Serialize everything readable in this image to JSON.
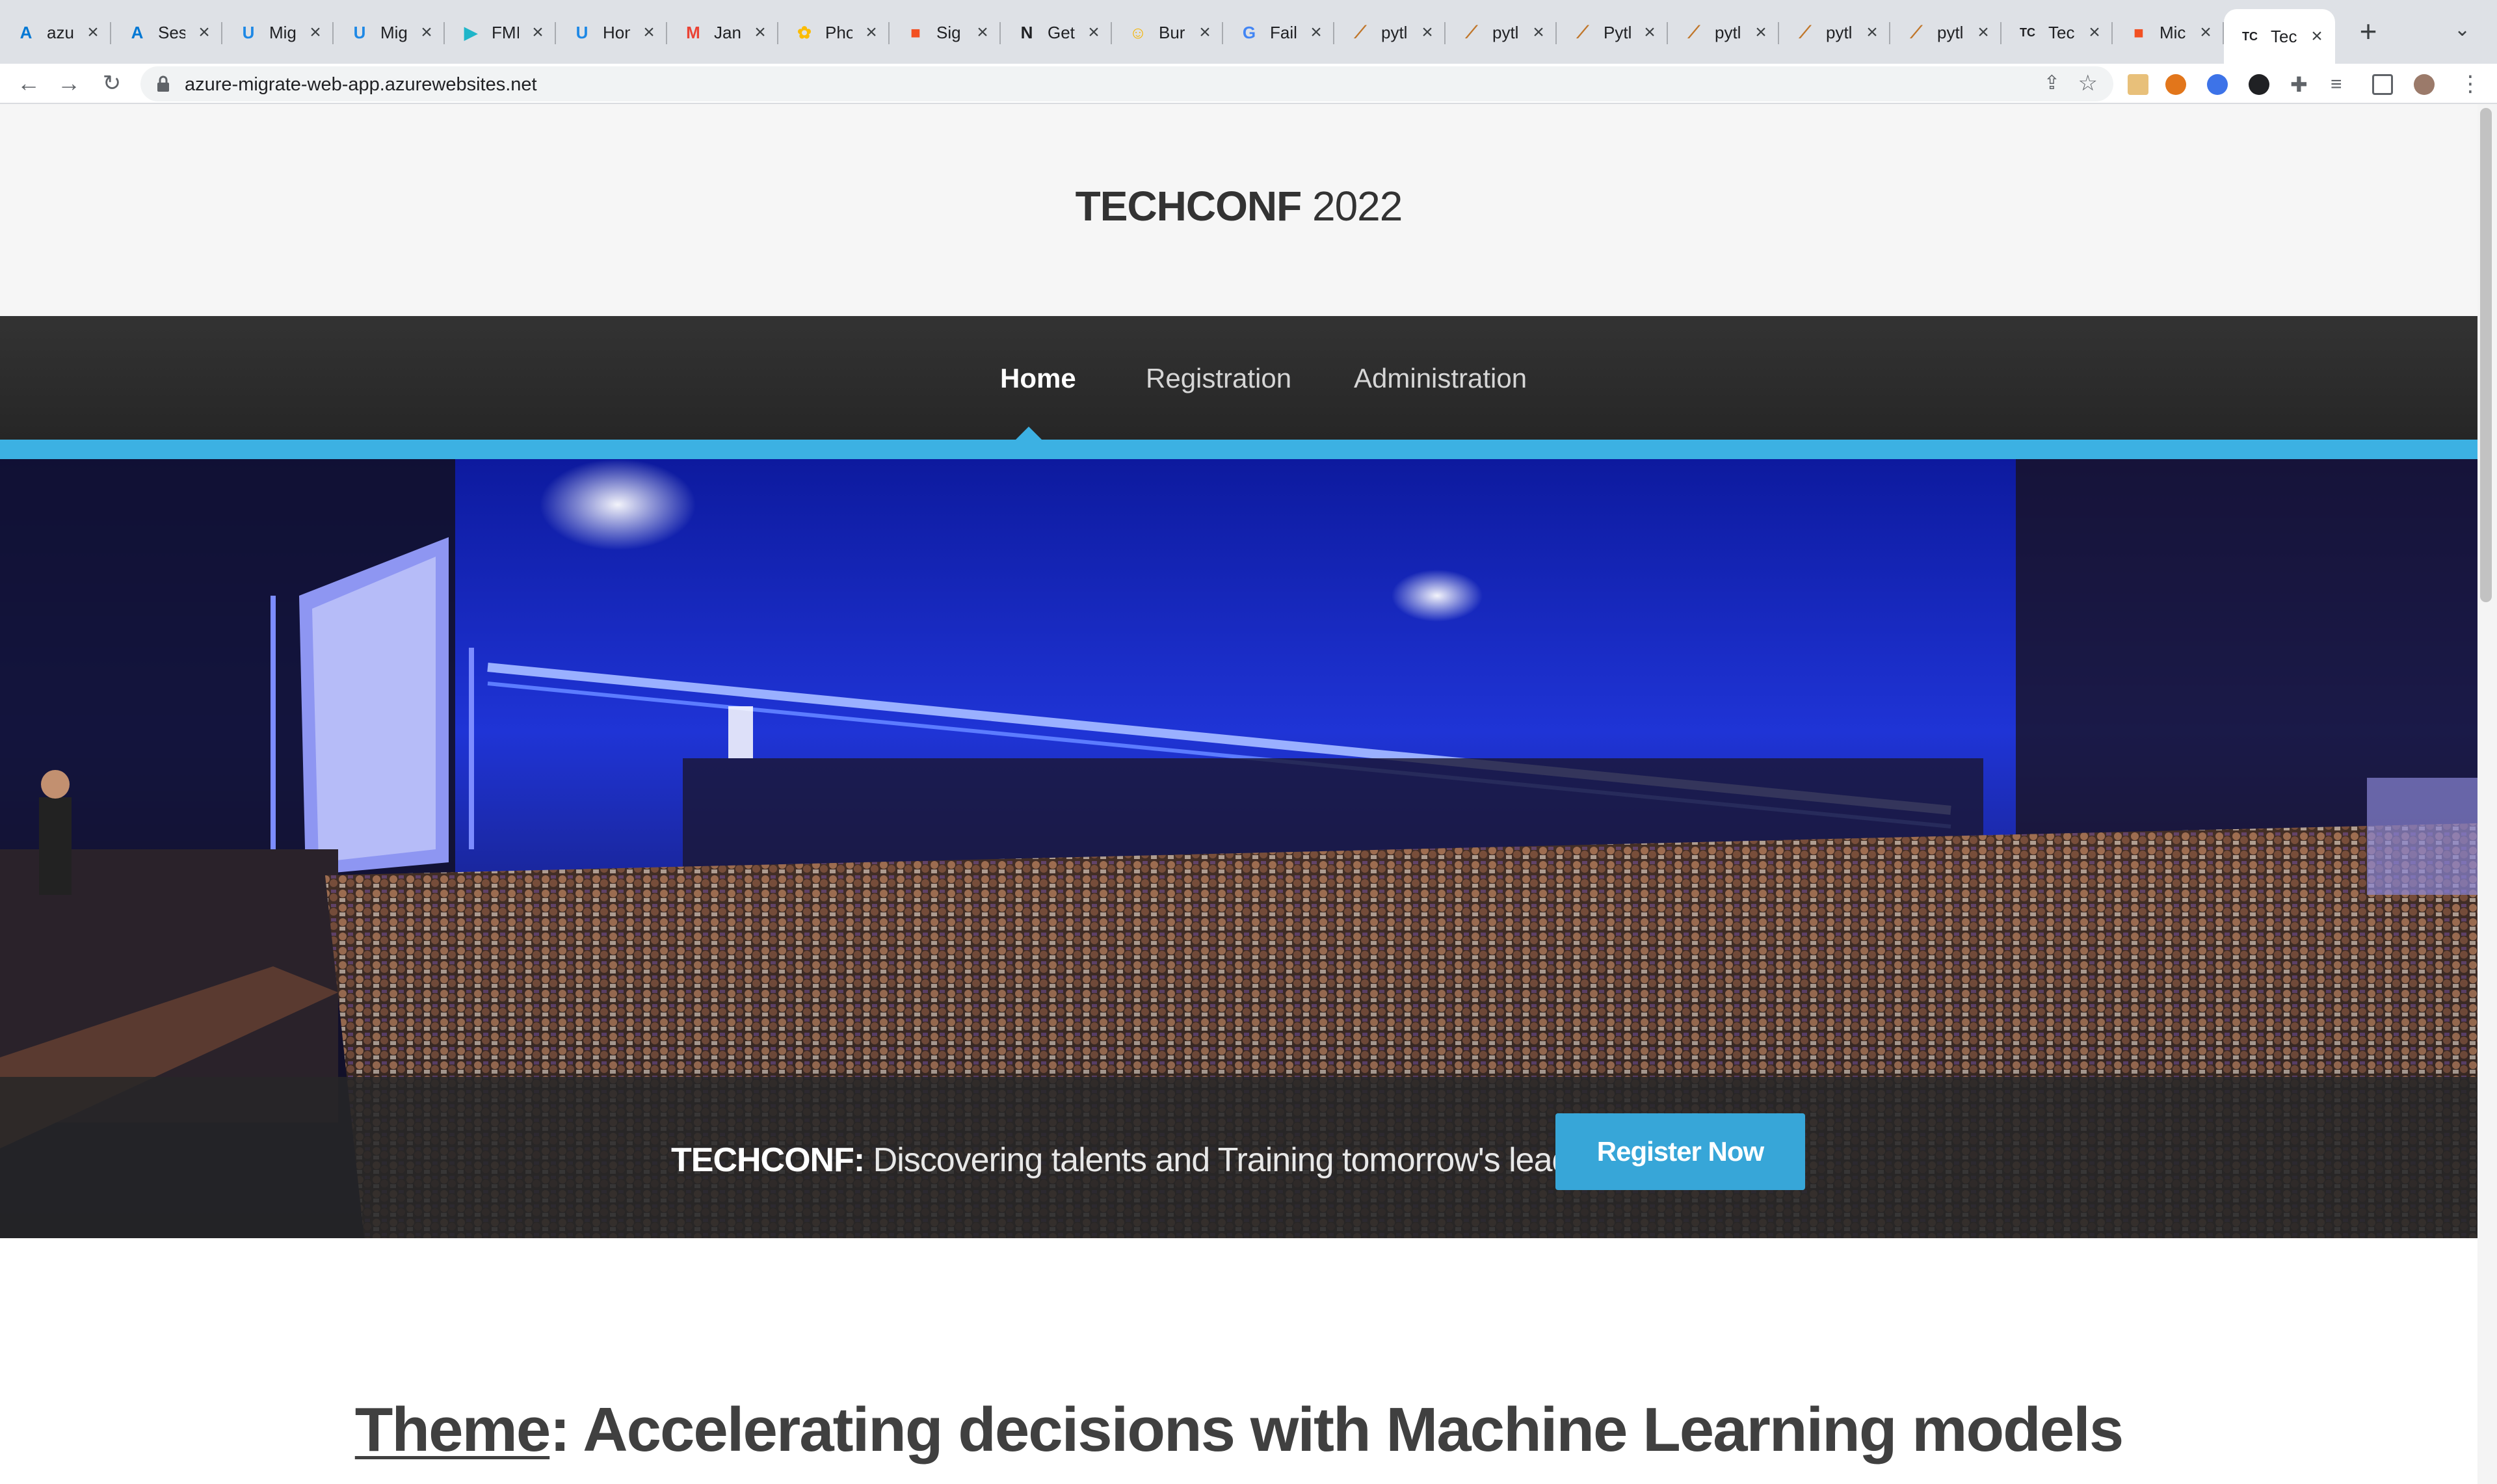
{
  "browser": {
    "tabs": [
      {
        "title": "azu",
        "favicon": "azure-icon",
        "color": "#0078d4",
        "glyph": "A"
      },
      {
        "title": "Ses",
        "favicon": "azure-icon",
        "color": "#0078d4",
        "glyph": "A"
      },
      {
        "title": "Mig",
        "favicon": "udacity-icon",
        "color": "#1e88e5",
        "glyph": "U"
      },
      {
        "title": "Mig",
        "favicon": "udacity-icon",
        "color": "#1e88e5",
        "glyph": "U"
      },
      {
        "title": "FMI",
        "favicon": "play-icon",
        "color": "#1fb5c9",
        "glyph": "▶"
      },
      {
        "title": "Hon",
        "favicon": "udacity-icon",
        "color": "#1e88e5",
        "glyph": "U"
      },
      {
        "title": "Jan",
        "favicon": "gmail-icon",
        "color": "#ea4335",
        "glyph": "M"
      },
      {
        "title": "Pho",
        "favicon": "photos-icon",
        "color": "#fbbc04",
        "glyph": "✿"
      },
      {
        "title": "Sig",
        "favicon": "microsoft-icon",
        "color": "#f25022",
        "glyph": "■"
      },
      {
        "title": "Get",
        "favicon": "notion-icon",
        "color": "#202124",
        "glyph": "N"
      },
      {
        "title": "Bur",
        "favicon": "bunny-icon",
        "color": "#f5b400",
        "glyph": "☺"
      },
      {
        "title": "Fail",
        "favicon": "google-icon",
        "color": "#4285f4",
        "glyph": "G"
      },
      {
        "title": "pytl",
        "favicon": "python-dev-icon",
        "color": "#c0762a",
        "glyph": "⟋"
      },
      {
        "title": "pytl",
        "favicon": "python-dev-icon",
        "color": "#c0762a",
        "glyph": "⟋"
      },
      {
        "title": "Pytl",
        "favicon": "python-dev-icon",
        "color": "#c0762a",
        "glyph": "⟋"
      },
      {
        "title": "pytl",
        "favicon": "python-dev-icon",
        "color": "#c0762a",
        "glyph": "⟋"
      },
      {
        "title": "pytl",
        "favicon": "python-dev-icon",
        "color": "#c0762a",
        "glyph": "⟋"
      },
      {
        "title": "pytl",
        "favicon": "python-dev-icon",
        "color": "#c0762a",
        "glyph": "⟋"
      },
      {
        "title": "Tec",
        "favicon": "techconf-icon",
        "color": "#202124",
        "glyph": "TC"
      },
      {
        "title": "Mic",
        "favicon": "microsoft-icon",
        "color": "#f25022",
        "glyph": "■"
      },
      {
        "title": "Tec",
        "favicon": "techconf-icon",
        "color": "#202124",
        "glyph": "TC",
        "active": true
      }
    ],
    "url": "azure-migrate-web-app.azurewebsites.net"
  },
  "site": {
    "brand_bold": "TECHCONF",
    "brand_year": " 2022",
    "nav": [
      {
        "label": "Home",
        "active": true
      },
      {
        "label": "Registration",
        "active": false
      },
      {
        "label": "Administration",
        "active": false
      }
    ],
    "hero": {
      "tagline_brand": "TECHCONF:",
      "tagline_text": " Discovering talents and Training tomorrow's leaders",
      "cta_label": "Register Now"
    },
    "theme": {
      "label": "Theme",
      "text": ": Accelerating decisions with Machine Learning models"
    }
  },
  "colors": {
    "accent": "#3cb1e3",
    "cta": "#37a6d8",
    "navbar": "#2d2d2d",
    "header_bg": "#f6f6f6"
  }
}
